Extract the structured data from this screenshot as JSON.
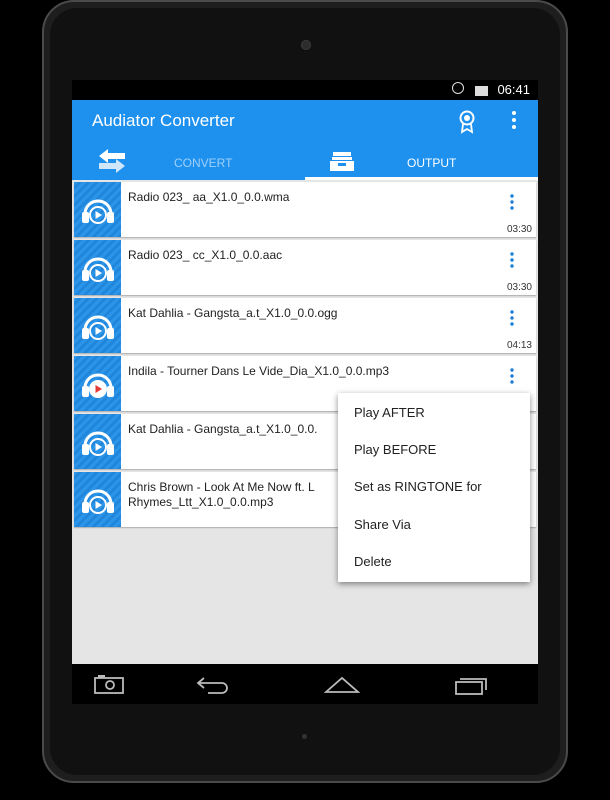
{
  "status_bar": {
    "time": "06:41",
    "icons": [
      "alarm-icon",
      "battery-icon"
    ]
  },
  "app": {
    "title": "Audiator Converter",
    "icons": [
      "award-icon",
      "overflow-menu-icon"
    ],
    "accent": "#1e90ee"
  },
  "tabs": [
    {
      "label": "CONVERT",
      "icon": "convert-arrows-icon",
      "selected": false
    },
    {
      "label": "OUTPUT",
      "icon": "output-tray-icon",
      "selected": true
    }
  ],
  "files": [
    {
      "name": "Radio 023_ aa_X1.0_0.0.wma",
      "duration": "03:30"
    },
    {
      "name": "Radio 023_ cc_X1.0_0.0.aac",
      "duration": "03:30"
    },
    {
      "name": "Kat Dahlia - Gangsta_a.t_X1.0_0.0.ogg",
      "duration": "04:13"
    },
    {
      "name": "Indila - Tourner Dans Le Vide_Dia_X1.0_0.0.mp3",
      "duration": "",
      "playing": true
    },
    {
      "name": "Kat Dahlia - Gangsta_a.t_X1.0_0.0.",
      "duration": ""
    },
    {
      "name": "Chris Brown - Look At Me Now ft. L",
      "name_line2": "Rhymes_Ltt_X1.0_0.0.mp3",
      "duration": ""
    }
  ],
  "context_menu": {
    "items": [
      "Play AFTER",
      "Play BEFORE",
      "Set as RINGTONE for",
      "Share Via",
      "Delete"
    ]
  },
  "nav_bar": {
    "icons": [
      "camera-icon",
      "back-icon",
      "home-icon",
      "recents-icon"
    ]
  }
}
